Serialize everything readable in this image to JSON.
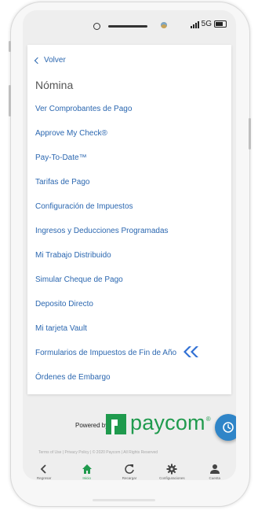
{
  "status_bar": {
    "network": "5G"
  },
  "card": {
    "back_label": "Volver",
    "title": "Nómina",
    "menu_items": [
      "Ver Comprobantes de Pago",
      "Approve My Check®",
      "Pay-To-Date™",
      "Tarifas de Pago",
      "Configuración de Impuestos",
      "Ingresos y Deducciones Programadas",
      "Mi Trabajo Distribuido",
      "Simular Cheque de Pago",
      "Deposito Directo",
      "Mi tarjeta Vault",
      "Formularios de Impuestos de Fin de Año",
      "Órdenes de Embargo"
    ]
  },
  "branding": {
    "powered_by": "Powered by",
    "brand_name": "paycom",
    "trademark": "®"
  },
  "footer": {
    "text": "Terms of Use | Privacy Policy | © 2020 Paycom | All Rights Reserved"
  },
  "nav": [
    {
      "label": "Regresar",
      "icon": "chevron-left-icon"
    },
    {
      "label": "Inicio",
      "icon": "home-icon"
    },
    {
      "label": "Recargar",
      "icon": "refresh-icon"
    },
    {
      "label": "Configuraciones",
      "icon": "gear-icon"
    },
    {
      "label": "Cuenta",
      "icon": "person-icon"
    }
  ],
  "colors": {
    "link": "#2b67b0",
    "brand_green": "#1f9a4d",
    "fab_blue": "#2f85c8",
    "arrow_blue": "#2f6fd4"
  }
}
